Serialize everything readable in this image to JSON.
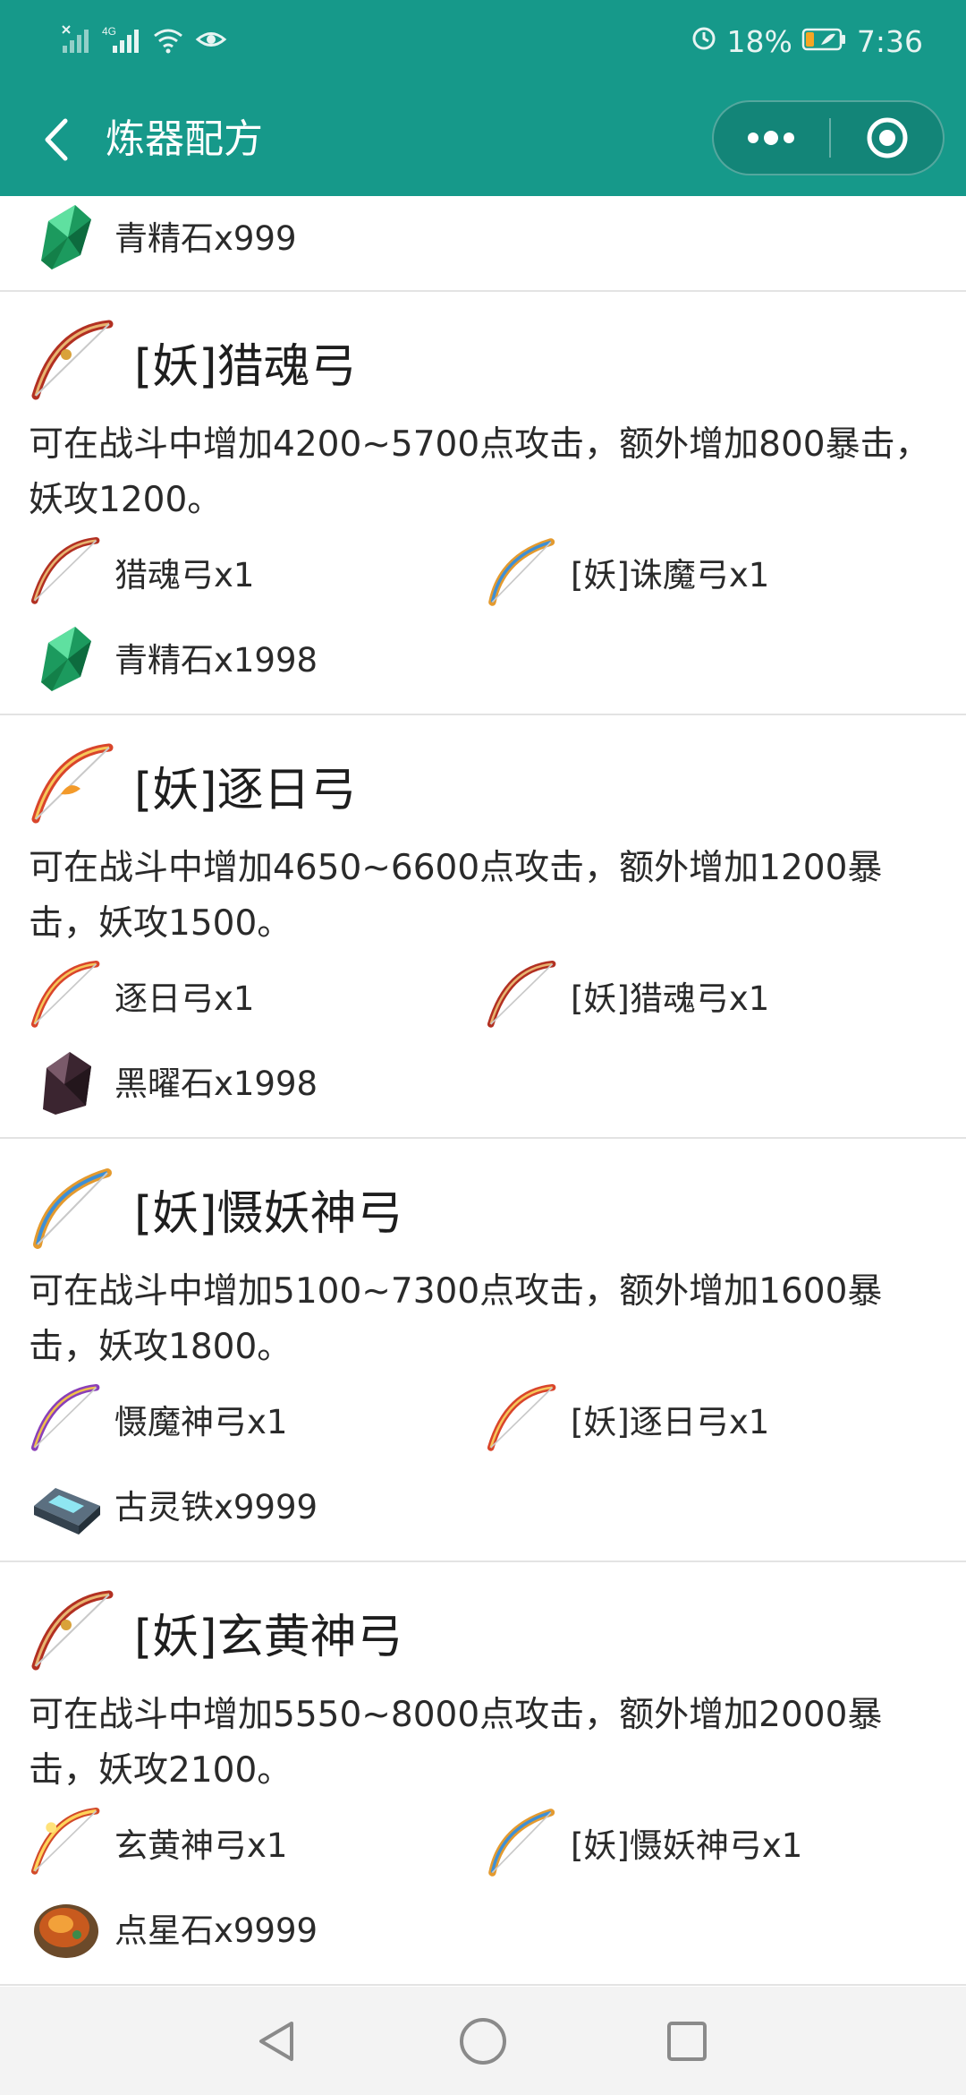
{
  "status_bar": {
    "battery_percent": "18%",
    "time": "7:36",
    "network": "4G"
  },
  "header": {
    "title": "炼器配方"
  },
  "partial_item": {
    "label": "青精石x999",
    "icon": "green-crystal-icon"
  },
  "recipes": [
    {
      "title": "[妖]猎魂弓",
      "icon": "red-bow-icon",
      "description": "可在战斗中增加4200~5700点攻击，额外增加800暴击，妖攻1200。",
      "materials": [
        {
          "label": "猎魂弓x1",
          "icon": "red-bow-icon"
        },
        {
          "label": "[妖]诛魔弓x1",
          "icon": "blue-gold-bow-icon"
        },
        {
          "label": "青精石x1998",
          "icon": "green-crystal-icon"
        }
      ]
    },
    {
      "title": "[妖]逐日弓",
      "icon": "flame-bow-icon",
      "description": "可在战斗中增加4650~6600点攻击，额外增加1200暴击，妖攻1500。",
      "materials": [
        {
          "label": "逐日弓x1",
          "icon": "flame-bow-icon"
        },
        {
          "label": "[妖]猎魂弓x1",
          "icon": "red-bow-icon"
        },
        {
          "label": "黑曜石x1998",
          "icon": "obsidian-icon"
        }
      ]
    },
    {
      "title": "[妖]慑妖神弓",
      "icon": "blue-gold-bow-icon",
      "description": "可在战斗中增加5100~7300点攻击，额外增加1600暴击，妖攻1800。",
      "materials": [
        {
          "label": "慑魔神弓x1",
          "icon": "purple-bow-icon"
        },
        {
          "label": "[妖]逐日弓x1",
          "icon": "flame-bow-icon"
        },
        {
          "label": "古灵铁x9999",
          "icon": "iron-ingot-icon"
        }
      ]
    },
    {
      "title": "[妖]玄黄神弓",
      "icon": "red-bow-icon",
      "description": "可在战斗中增加5550~8000点攻击，额外增加2000暴击，妖攻2100。",
      "materials": [
        {
          "label": "玄黄神弓x1",
          "icon": "golden-bow-icon"
        },
        {
          "label": "[妖]慑妖神弓x1",
          "icon": "blue-gold-bow-icon"
        },
        {
          "label": "点星石x9999",
          "icon": "star-stone-icon"
        }
      ]
    }
  ],
  "colors": {
    "header": "#16998a",
    "divider": "#e3e3e3",
    "navbar": "#f3f3f3"
  }
}
